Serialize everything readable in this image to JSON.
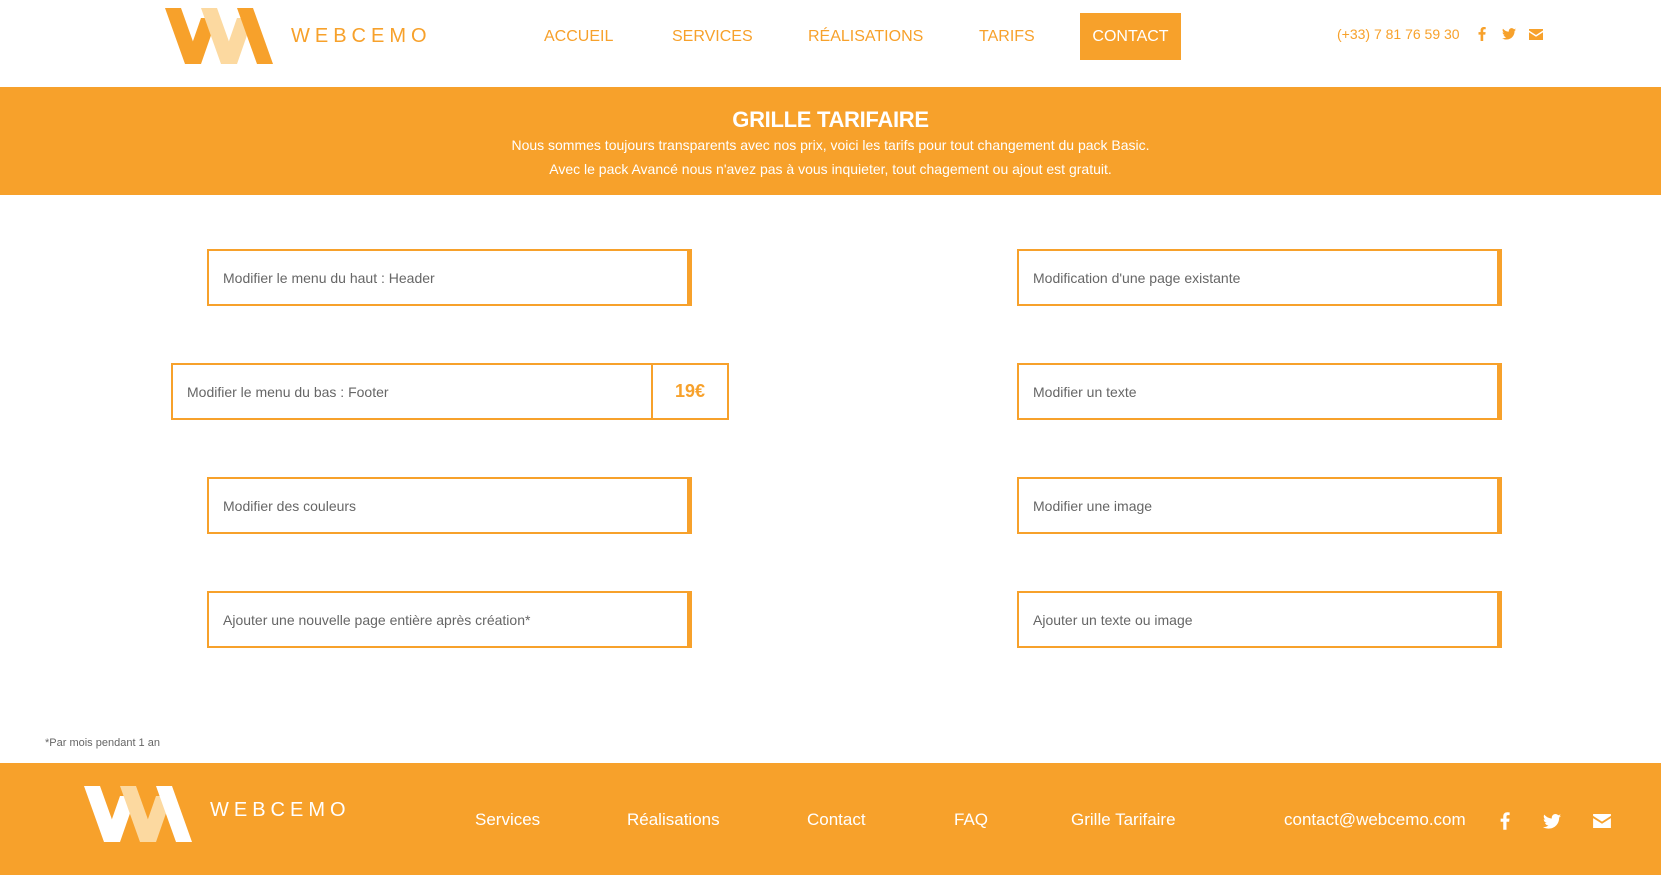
{
  "brand": {
    "name": "WEBCEMO",
    "accent_color": "#f7a12b",
    "accent_light": "#fcd9a0"
  },
  "header": {
    "nav": [
      {
        "label": "ACCUEIL"
      },
      {
        "label": "SERVICES"
      },
      {
        "label": "RÉALISATIONS"
      },
      {
        "label": "TARIFS"
      },
      {
        "label": "CONTACT",
        "active": true
      }
    ],
    "phone": "(+33) 7 81 76 59 30",
    "icons": [
      "facebook-icon",
      "twitter-icon",
      "envelope-icon"
    ]
  },
  "banner": {
    "title": "GRILLE TARIFAIRE",
    "line1": "Nous sommes toujours transparents avec nos prix, voici les tarifs pour tout changement du pack Basic.",
    "line2": "Avec le pack Avancé nous n'avez pas à vous inquieter, tout chagement ou ajout est gratuit."
  },
  "pricing": {
    "left": [
      {
        "label": "Modifier le menu du haut : Header"
      },
      {
        "label": "Modifier le menu du bas : Footer",
        "price": "19€"
      },
      {
        "label": "Modifier des couleurs"
      },
      {
        "label": "Ajouter une nouvelle page entière après création*"
      }
    ],
    "right": [
      {
        "label": "Modification d'une page existante"
      },
      {
        "label": "Modifier un texte"
      },
      {
        "label": "Modifier une image"
      },
      {
        "label": "Ajouter un texte ou image"
      }
    ],
    "footnote": "*Par mois pendant 1 an"
  },
  "footer": {
    "links": [
      {
        "label": "Services"
      },
      {
        "label": "Réalisations"
      },
      {
        "label": "Contact"
      },
      {
        "label": "FAQ"
      },
      {
        "label": "Grille Tarifaire"
      }
    ],
    "email": "contact@webcemo.com",
    "icons": [
      "facebook-icon",
      "twitter-icon",
      "envelope-icon"
    ]
  }
}
